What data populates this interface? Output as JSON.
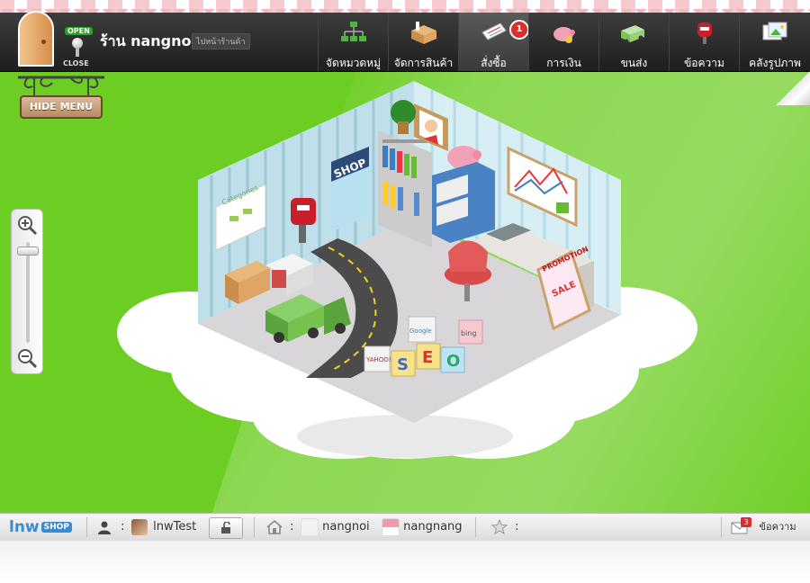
{
  "topbar": {
    "open_label": "OPEN",
    "close_label": "CLOSE",
    "shop_name": "ร้าน nangnoi",
    "goto_shop_label": "ไปหน้าร้านค้า",
    "nav": [
      {
        "label": "จัดหมวดหมู่",
        "icon": "category-tree-icon"
      },
      {
        "label": "จัดการสินค้า",
        "icon": "product-boxes-icon"
      },
      {
        "label": "สั่งซื้อ",
        "icon": "order-document-icon",
        "badge": "1",
        "active": true
      },
      {
        "label": "การเงิน",
        "icon": "piggy-bank-icon"
      },
      {
        "label": "ขนส่ง",
        "icon": "delivery-truck-icon"
      },
      {
        "label": "ข้อความ",
        "icon": "mailbox-icon"
      },
      {
        "label": "คลังรูปภาพ",
        "icon": "photo-gallery-icon"
      }
    ]
  },
  "hide_menu_label": "HIDE MENU",
  "zoom": {
    "level": 0.05
  },
  "scene": {
    "shop_sign": "SHOP",
    "categories_poster": "Categories",
    "promotion_label": "PROMOTION",
    "sale_label": "SALE",
    "seo_blocks": [
      "S",
      "E",
      "O"
    ],
    "cube_labels": [
      "Google",
      "bing",
      "YAHOO!"
    ]
  },
  "bottombar": {
    "logo_text": "lnw",
    "logo_badge": "SHOP",
    "username": "lnwTest",
    "shops": [
      "nangnoi",
      "nangnang"
    ],
    "favorites_label": ":",
    "user_label": ":",
    "home_label": ":",
    "messages_label": "ข้อความ",
    "messages_badge": "3"
  },
  "colors": {
    "background_green": "#6ccd22",
    "topbar_dark": "#2a2a2a",
    "badge_red": "#d9302b",
    "awning_pink": "#f6c9cf"
  }
}
